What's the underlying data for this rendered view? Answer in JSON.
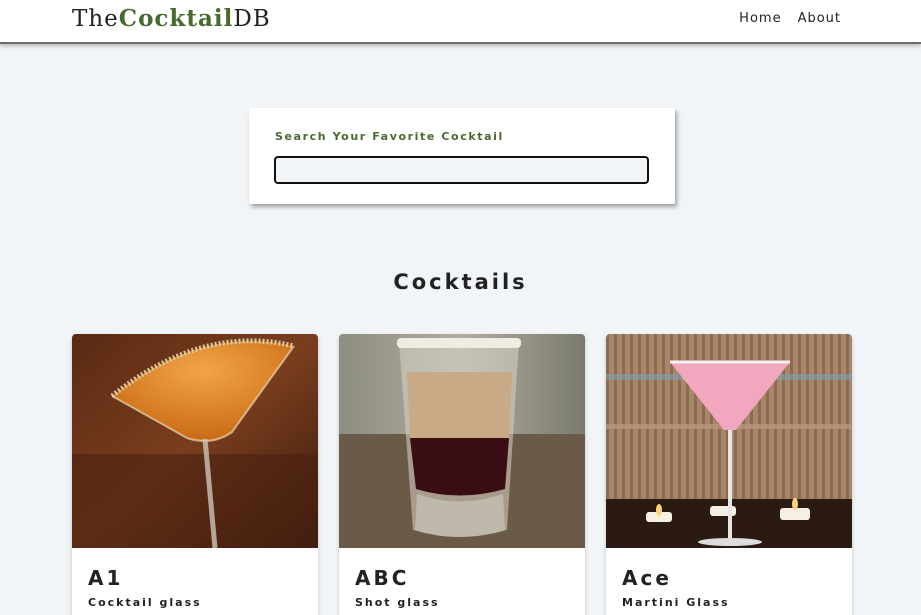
{
  "navbar": {
    "logo_prefix": "The",
    "logo_accent": "Cocktail",
    "logo_suffix": "DB",
    "links": [
      {
        "label": "Home"
      },
      {
        "label": "About"
      }
    ]
  },
  "search": {
    "label": "Search Your Favorite Cocktail",
    "value": ""
  },
  "section": {
    "title": "Cocktails"
  },
  "cocktails": [
    {
      "name": "A1",
      "glass": "Cocktail glass"
    },
    {
      "name": "ABC",
      "glass": "Shot glass"
    },
    {
      "name": "Ace",
      "glass": "Martini Glass"
    }
  ],
  "colors": {
    "accent": "#476a2e",
    "background": "#f1f5f8"
  }
}
